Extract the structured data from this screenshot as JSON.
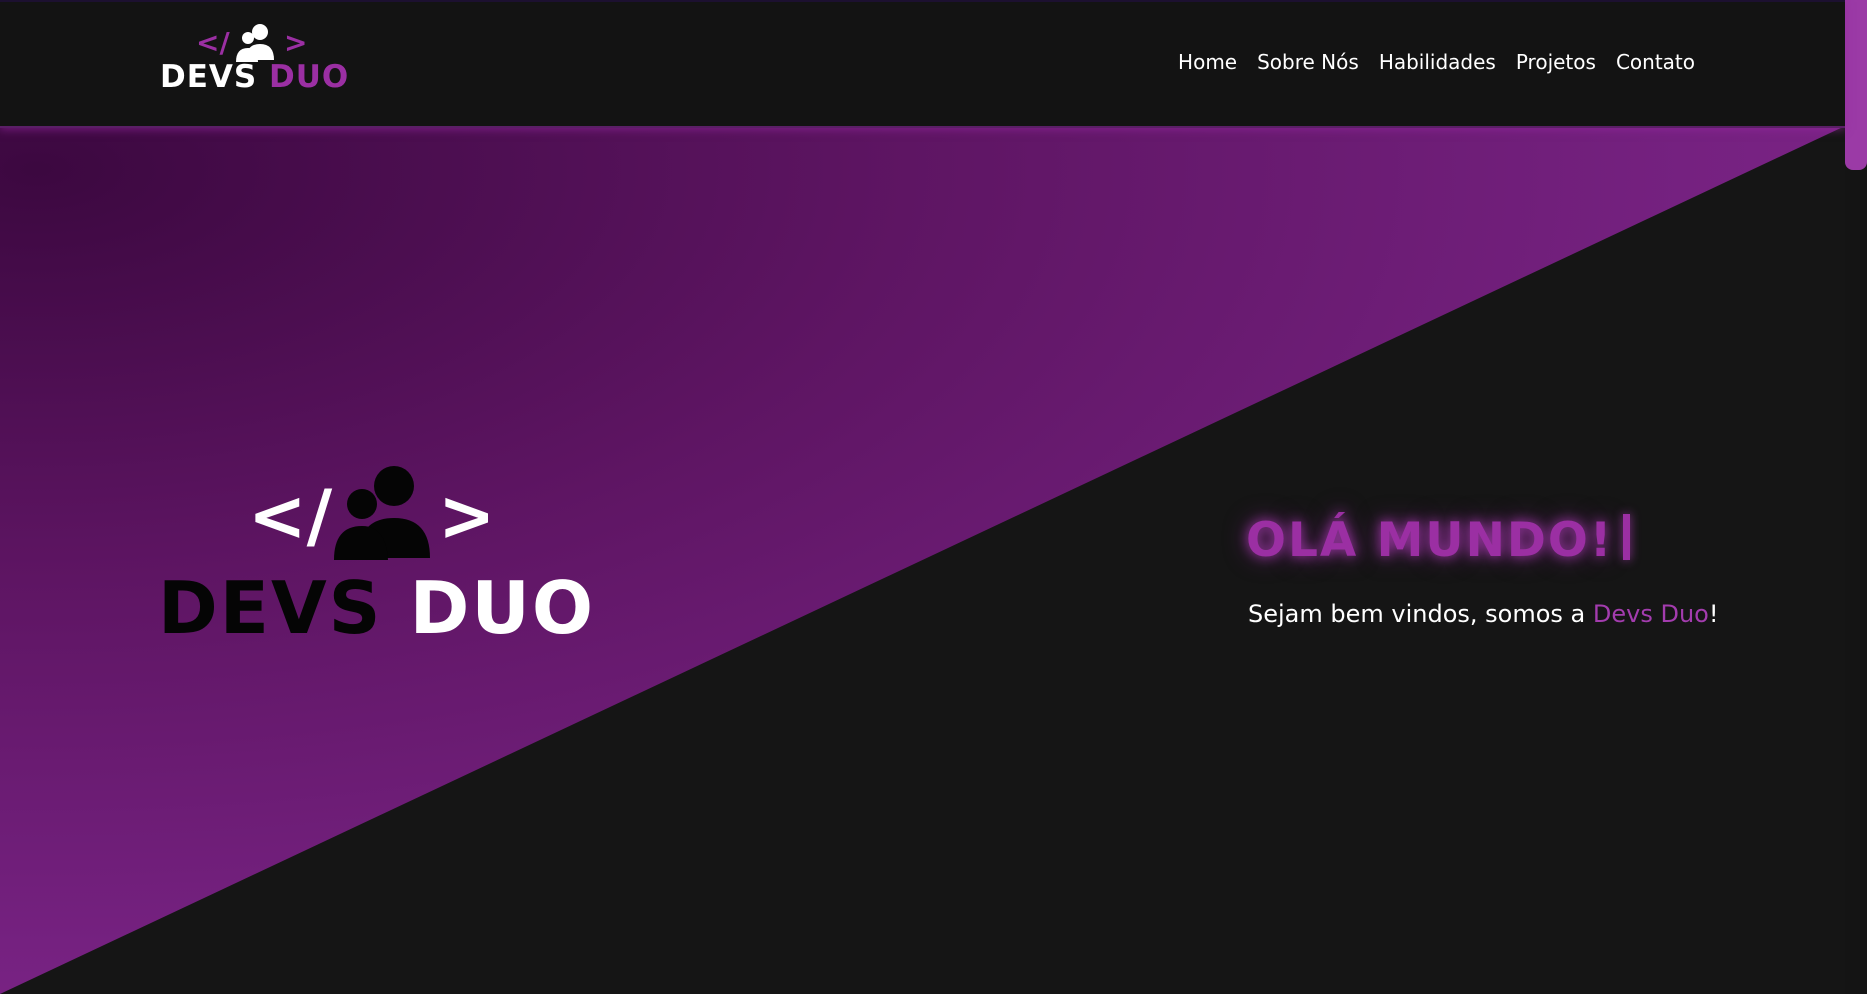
{
  "brand": {
    "part1": "DEVS",
    "part2": "DUO",
    "tag_open": "</",
    "tag_close": ">"
  },
  "nav": {
    "items": [
      {
        "label": "Home"
      },
      {
        "label": "Sobre Nós"
      },
      {
        "label": "Habilidades"
      },
      {
        "label": "Projetos"
      },
      {
        "label": "Contato"
      }
    ]
  },
  "hero": {
    "title": "OLÁ MUNDO!",
    "subtitle_pre": "Sejam bem vindos, somos a ",
    "subtitle_highlight": "Devs Duo",
    "subtitle_post": "!"
  },
  "icons": {
    "logo_icon": "users-icon",
    "code_bracket": "code-tag-icon"
  },
  "colors": {
    "accent": "#9b2fa3",
    "background": "#151515",
    "header": "#131313",
    "gradient_dark": "#3c0840",
    "gradient_light": "#7a2380"
  }
}
